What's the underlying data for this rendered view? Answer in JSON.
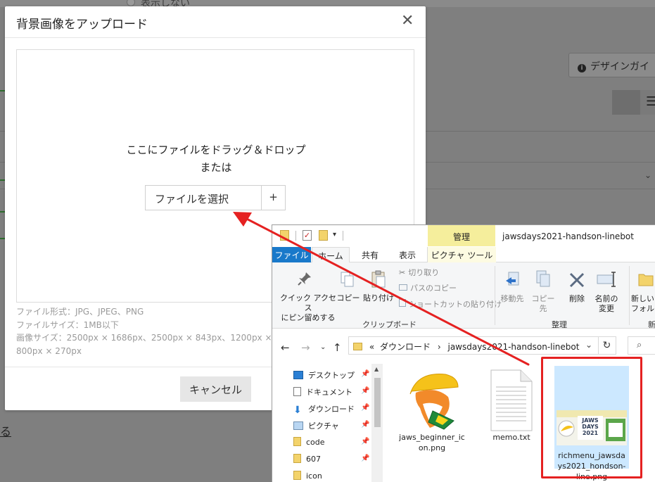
{
  "background": {
    "radio_label": "表示しない",
    "guide_button": "デザインガイ",
    "list_icon": "list-icon",
    "grid_icon": "grid-icon",
    "link_text": "る"
  },
  "modal": {
    "title": "背景画像をアップロード",
    "close_icon": "close-icon",
    "drop_text_1": "ここにファイルをドラッグ＆ドロップ",
    "drop_text_2": "または",
    "choose_file": "ファイルを選択",
    "plus": "+",
    "info": [
      "ファイル形式：JPG、JPEG、PNG",
      "ファイルサイズ：1MB以下",
      "画像サイズ：2500px × 1686px、2500px × 843px、1200px × 810px、",
      "800px × 270px"
    ],
    "cancel": "キャンセル"
  },
  "explorer": {
    "manage_tab": "管理",
    "window_title": "jawsdays2021-handson-linebot",
    "tabs": {
      "file": "ファイル",
      "home": "ホーム",
      "share": "共有",
      "view": "表示",
      "picture_tools": "ピクチャ ツール"
    },
    "ribbon": {
      "pin_quick_access": [
        "クイック アクセス",
        "にピン留めする"
      ],
      "copy": "コピー",
      "paste": "貼り付け",
      "cut": "切り取り",
      "copy_path": "パスのコピー",
      "paste_shortcut": "ショートカットの貼り付け",
      "clipboard_group": "クリップボード",
      "move_to": "移動先",
      "copy_to": "コピー先",
      "delete": "削除",
      "rename": [
        "名前の",
        "変更"
      ],
      "organize_group": "整理",
      "new_folder": [
        "新しい",
        "フォルダー"
      ],
      "new_group": "新"
    },
    "address": {
      "prefix": "«",
      "crumbs": [
        "ダウンロード",
        "jawsdays2021-handson-linebot"
      ]
    },
    "nav_items": [
      {
        "label": "デスクトップ",
        "icon": "desktop-icon",
        "pinned": true
      },
      {
        "label": "ドキュメント",
        "icon": "document-icon",
        "pinned": true
      },
      {
        "label": "ダウンロード",
        "icon": "download-icon",
        "pinned": true
      },
      {
        "label": "ピクチャ",
        "icon": "pictures-icon",
        "pinned": true
      },
      {
        "label": "code",
        "icon": "folder-icon",
        "pinned": true
      },
      {
        "label": "607",
        "icon": "folder-icon",
        "pinned": true
      },
      {
        "label": "icon",
        "icon": "folder-icon",
        "pinned": false
      }
    ],
    "files": [
      {
        "name": [
          "jaws_beginner_ic",
          "on.png"
        ],
        "icon": "shark-image-thumbnail"
      },
      {
        "name": [
          "memo.txt"
        ],
        "icon": "text-file-icon"
      },
      {
        "name": [
          "richmenu_jawsda",
          "ys2021_hondson-",
          "line.png"
        ],
        "icon": "richmenu-image-thumbnail",
        "thumb_text": [
          "JAWS",
          "DAYS",
          "2021"
        ]
      }
    ]
  },
  "colors": {
    "accent_blue": "#1979ca",
    "annotation_red": "#e52121",
    "manage_yellow": "#f5ee9c"
  }
}
